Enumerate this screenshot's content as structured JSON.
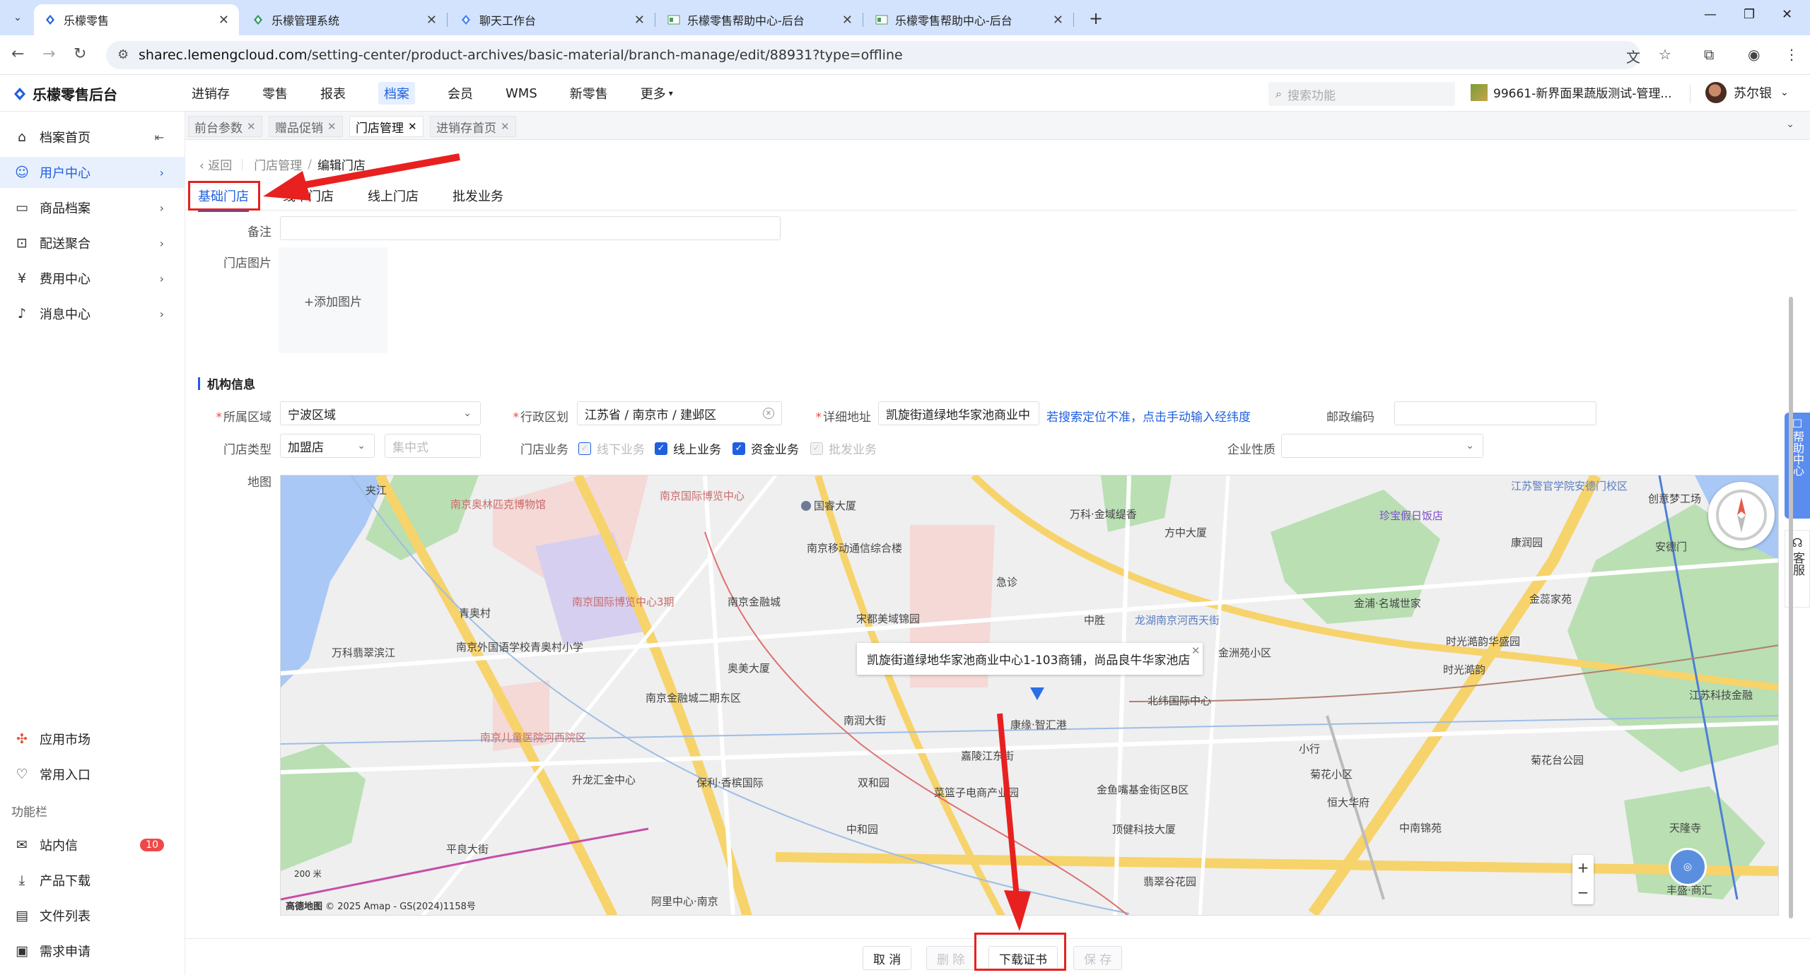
{
  "browser": {
    "tabs": [
      {
        "label": "乐檬零售",
        "icon": "lemeng-logo-icon",
        "active": true
      },
      {
        "label": "乐檬管理系统",
        "icon": "lemeng-green-icon",
        "active": false
      },
      {
        "label": "聊天工作台",
        "icon": "lemeng-logo-icon",
        "active": false
      },
      {
        "label": "乐檬零售帮助中心-后台",
        "icon": "doc-icon",
        "active": false
      },
      {
        "label": "乐檬零售帮助中心-后台",
        "icon": "doc-icon",
        "active": false
      }
    ],
    "url_host": "sharec.lemengcloud.com",
    "url_path": "/setting-center/product-archives/basic-material/branch-manage/edit/88931?type=offline"
  },
  "header": {
    "logo": "乐檬零售后台",
    "nav": [
      "进销存",
      "零售",
      "报表",
      "档案",
      "会员",
      "WMS",
      "新零售",
      "更多"
    ],
    "active_nav": "档案",
    "search_placeholder": "搜索功能",
    "store": "99661-新界面果蔬版测试-管理...",
    "user": "苏尔银"
  },
  "sidebar": {
    "items": [
      {
        "label": "档案首页",
        "icon": "home-icon"
      },
      {
        "label": "用户中心",
        "icon": "user-icon",
        "active": true
      },
      {
        "label": "商品档案",
        "icon": "box-icon"
      },
      {
        "label": "配送聚合",
        "icon": "delivery-icon"
      },
      {
        "label": "费用中心",
        "icon": "yuan-icon"
      },
      {
        "label": "消息中心",
        "icon": "bell-icon"
      }
    ],
    "bottom_items": [
      {
        "label": "应用市场",
        "icon": "app-market-icon"
      },
      {
        "label": "常用入口",
        "icon": "heart-icon"
      }
    ],
    "group_title": "功能栏",
    "tools": [
      {
        "label": "站内信",
        "icon": "mail-icon",
        "badge": "10"
      },
      {
        "label": "产品下载",
        "icon": "download-icon"
      },
      {
        "label": "文件列表",
        "icon": "file-list-icon"
      },
      {
        "label": "需求申请",
        "icon": "request-icon"
      }
    ]
  },
  "page_tabs": [
    {
      "label": "前台参数"
    },
    {
      "label": "赠品促销"
    },
    {
      "label": "门店管理",
      "active": true
    },
    {
      "label": "进销存首页"
    }
  ],
  "breadcrumb": {
    "back": "返回",
    "parent": "门店管理",
    "current": "编辑门店"
  },
  "form_tabs": [
    "基础门店",
    "线下门店",
    "线上门店",
    "批发业务"
  ],
  "form": {
    "remark_label": "备注",
    "remark_value": "",
    "image_label": "门店图片",
    "add_image": "+添加图片",
    "section_title": "机构信息",
    "region_label": "所属区域",
    "region_value": "宁波区域",
    "district_label": "行政区划",
    "district_value": "江苏省 / 南京市 / 建邺区",
    "address_label": "详细地址",
    "address_value": "凯旋街道绿地华家池商业中",
    "address_link": "若搜索定位不准，点击手动输入经纬度",
    "zip_label": "邮政编码",
    "zip_value": "",
    "store_type_label": "门店类型",
    "store_type_value": "加盟店",
    "mode_placeholder": "集中式",
    "business_label": "门店业务",
    "business_options": [
      {
        "label": "线下业务",
        "checked": true,
        "disabled": true
      },
      {
        "label": "线上业务",
        "checked": true,
        "disabled": false
      },
      {
        "label": "资金业务",
        "checked": true,
        "disabled": false
      },
      {
        "label": "批发业务",
        "checked": false,
        "disabled": true
      }
    ],
    "nature_label": "企业性质",
    "nature_value": "",
    "map_label": "地图"
  },
  "map": {
    "popup": "凯旋街道绿地华家池商业中心1-103商铺，尚品良牛华家池店",
    "scale": "200 米",
    "copyright": "© 2025 Amap - GS(2024)1158号",
    "brand": "高德地图",
    "labels": [
      {
        "t": "夹江",
        "c": ""
      },
      {
        "t": "南京奥林匹克博物馆",
        "c": "pink"
      },
      {
        "t": "南京国际博览中心",
        "c": "pink"
      },
      {
        "t": "国睿大厦",
        "c": ""
      },
      {
        "t": "南京移动通信综合楼",
        "c": ""
      },
      {
        "t": "急诊",
        "c": ""
      },
      {
        "t": "万科·金域缇香",
        "c": ""
      },
      {
        "t": "方中大厦",
        "c": ""
      },
      {
        "t": "珍宝假日饭店",
        "c": "purple"
      },
      {
        "t": "江苏警官学院安德门校区",
        "c": "blue"
      },
      {
        "t": "创意梦工场",
        "c": ""
      },
      {
        "t": "康润园",
        "c": ""
      },
      {
        "t": "安德门",
        "c": ""
      },
      {
        "t": "青奥村",
        "c": ""
      },
      {
        "t": "南京国际博览中心3期",
        "c": "pink"
      },
      {
        "t": "南京金融城",
        "c": ""
      },
      {
        "t": "宋都美域锦园",
        "c": ""
      },
      {
        "t": "中胜",
        "c": ""
      },
      {
        "t": "龙湖南京河西天街",
        "c": "blue"
      },
      {
        "t": "金浦·名城世家",
        "c": ""
      },
      {
        "t": "金蕊家苑",
        "c": ""
      },
      {
        "t": "万科翡翠滨江",
        "c": ""
      },
      {
        "t": "南京外国语学校青奥村小学",
        "c": ""
      },
      {
        "t": "奥美大厦",
        "c": ""
      },
      {
        "t": "金洲苑小区",
        "c": ""
      },
      {
        "t": "时光澔韵华盛园",
        "c": ""
      },
      {
        "t": "时光澔韵",
        "c": ""
      },
      {
        "t": "南京金融城二期东区",
        "c": ""
      },
      {
        "t": "南润大街",
        "c": ""
      },
      {
        "t": "康缘·智汇港",
        "c": ""
      },
      {
        "t": "北纬国际中心",
        "c": ""
      },
      {
        "t": "江苏科技金融",
        "c": ""
      },
      {
        "t": "南京儿童医院河西院区",
        "c": "pink"
      },
      {
        "t": "嘉陵江东街",
        "c": ""
      },
      {
        "t": "小行",
        "c": ""
      },
      {
        "t": "菊花小区",
        "c": ""
      },
      {
        "t": "菊花台公园",
        "c": ""
      },
      {
        "t": "升龙汇金中心",
        "c": ""
      },
      {
        "t": "保利·香槟国际",
        "c": ""
      },
      {
        "t": "双和园",
        "c": ""
      },
      {
        "t": "菜篮子电商产业园",
        "c": ""
      },
      {
        "t": "金鱼嘴基金街区B区",
        "c": ""
      },
      {
        "t": "恒大华府",
        "c": ""
      },
      {
        "t": "中和园",
        "c": ""
      },
      {
        "t": "顶健科技大厦",
        "c": ""
      },
      {
        "t": "中南锦苑",
        "c": ""
      },
      {
        "t": "天隆寺",
        "c": ""
      },
      {
        "t": "平良大街",
        "c": ""
      },
      {
        "t": "翡翠谷花园",
        "c": ""
      },
      {
        "t": "丰盛·商汇",
        "c": ""
      },
      {
        "t": "阿里中心·南京",
        "c": ""
      }
    ]
  },
  "footer": {
    "cancel": "取 消",
    "delete": "删 除",
    "download": "下载证书",
    "save": "保 存"
  },
  "helper": {
    "help": "帮助中心",
    "cs": "客服"
  },
  "colors": {
    "primary": "#1f5fe0",
    "annotation": "#e82020",
    "tabstrip": "#d3e3fd"
  }
}
